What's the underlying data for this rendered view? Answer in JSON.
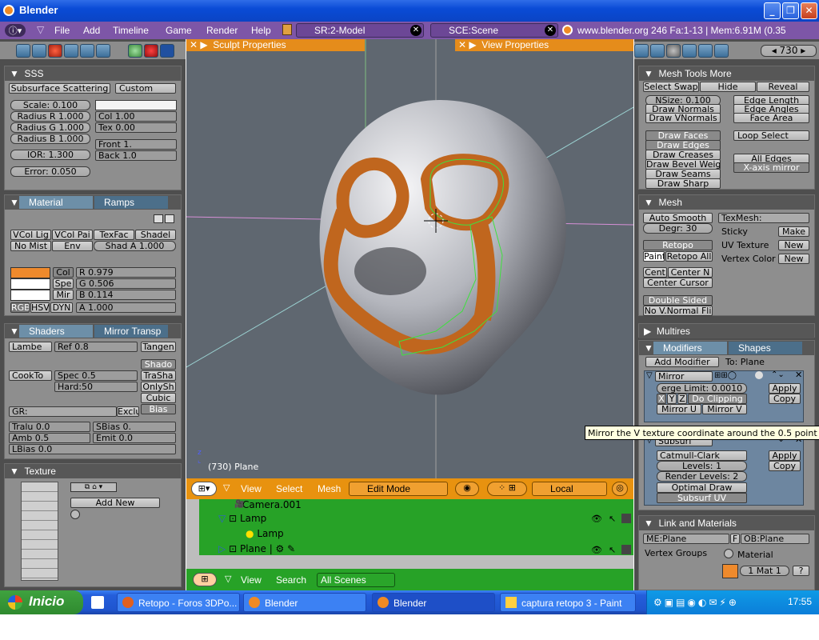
{
  "window": {
    "title": "Blender"
  },
  "info_header": {
    "menus": [
      "File",
      "Add",
      "Timeline",
      "Game",
      "Render",
      "Help"
    ],
    "screen": "SR:2-Model",
    "scene": "SCE:Scene",
    "stats": "www.blender.org 246  Fa:1-13 | Mem:6.91M (0.35"
  },
  "left_panels": {
    "sss": {
      "header": "SSS",
      "toggle": "Subsurface Scattering",
      "preset": "Custom",
      "scale": "Scale: 0.100",
      "radius_r": "Radius R 1.000",
      "radius_g": "Radius G 1.000",
      "radius_b": "Radius B 1.000",
      "ior": "IOR: 1.300",
      "error": "Error: 0.050",
      "col": "Col 1.00",
      "tex": "Tex 0.00",
      "front": "Front 1.",
      "back": "Back 1.0"
    },
    "material": {
      "tab1": "Material",
      "tab2": "Ramps",
      "row1": [
        "VCol Lig",
        "VCol Pai",
        "TexFac",
        "Shadel"
      ],
      "row2": [
        "No Mist",
        "Env",
        "Shad A 1.000"
      ],
      "col_tabs": [
        "Col",
        "Spe",
        "Mir"
      ],
      "r": "R 0.979",
      "g": "G 0.506",
      "b": "B 0.114",
      "a": "A 1.000",
      "modes": [
        "RGB",
        "HSV",
        "DYN"
      ],
      "color": "#ef8a2c"
    },
    "shaders": {
      "tab1": "Shaders",
      "tab2": "Mirror Transp",
      "diffuse": "Lambe",
      "ref": "Ref   0.8",
      "tangent": "Tangen",
      "spec_shader": "CookTo",
      "spec": "Spec 0.5",
      "hard": "Hard:50",
      "right_btns": [
        "Shado",
        "TraSha",
        "OnlySh",
        "Cubic",
        "Bias"
      ],
      "gr": "GR:",
      "exclusive": "Exclusive",
      "tralu": "Tralu 0.0",
      "sbias": "SBias 0.",
      "amb": "Amb 0.5",
      "emit": "Emit 0.0",
      "lbias": "LBias 0.0"
    },
    "texture": {
      "header": "Texture",
      "add_new": "Add New"
    }
  },
  "viewport": {
    "sculpt_props": "Sculpt Properties",
    "view_props": "View Properties",
    "object_label": "(730) Plane",
    "header_menus": [
      "View",
      "Select",
      "Mesh"
    ],
    "mode": "Edit Mode",
    "orientation": "Local"
  },
  "outliner": {
    "items": [
      "Camera.001",
      "Lamp",
      "Lamp",
      "Plane"
    ],
    "menus": [
      "View",
      "Search"
    ],
    "filter": "All Scenes"
  },
  "right_panels": {
    "frame": "730",
    "mesh_tools_more": {
      "header": "Mesh Tools More",
      "row1": [
        "Select Swap",
        "Hide",
        "Reveal"
      ],
      "nsize": "NSize: 0.100",
      "left": [
        "Draw Normals",
        "Draw VNormals"
      ],
      "right": [
        "Edge Length",
        "Edge Angles",
        "Face Area"
      ],
      "draw": [
        "Draw Faces",
        "Draw Edges",
        "Draw Creases",
        "Draw Bevel Weig",
        "Draw Seams",
        "Draw Sharp"
      ],
      "loop": "Loop Select",
      "all_edges": "All Edges",
      "xmirror": "X-axis mirror"
    },
    "mesh": {
      "header": "Mesh",
      "auto_smooth": "Auto Smooth",
      "degr": "Degr: 30",
      "texmesh": "TexMesh:",
      "sticky": "Sticky",
      "make": "Make",
      "uv_texture": "UV Texture",
      "vertex_color": "Vertex Color",
      "new": "New",
      "retopo": "Retopo",
      "paint": "Paint",
      "retopo_all": "Retopo All",
      "cent": "Cent",
      "center_n": "Center N",
      "center_cursor": "Center Cursor",
      "double_sided": "Double Sided",
      "no_vnormal": "No V.Normal Fli"
    },
    "multires": {
      "header": "Multires"
    },
    "modifiers": {
      "tab1": "Modifiers",
      "tab2": "Shapes",
      "add": "Add Modifier",
      "to": "To: Plane",
      "mirror": {
        "name": "Mirror",
        "merge": "erge Limit: 0.0010",
        "axes": [
          "X",
          "Y",
          "Z"
        ],
        "clip": "Do Clipping",
        "mirror_u": "Mirror U",
        "mirror_v": "Mirror V",
        "apply": "Apply",
        "copy": "Copy"
      },
      "subsurf": {
        "name": "Subsurf",
        "type": "Catmull-Clark",
        "levels": "Levels: 1",
        "render": "Render Levels: 2",
        "optimal": "Optimal Draw",
        "uv": "Subsurf UV",
        "apply": "Apply",
        "copy": "Copy"
      }
    },
    "link": {
      "header": "Link and Materials",
      "me": "ME:Plane",
      "f": "F",
      "ob": "OB:Plane",
      "vgroups": "Vertex Groups",
      "material": "Material",
      "mat": "1 Mat 1"
    }
  },
  "tooltip": "Mirror the V texture coordinate around the 0.5 point",
  "taskbar": {
    "start": "Inicio",
    "tasks": [
      "Retopo - Foros 3DPo...",
      "Blender",
      "Blender",
      "captura retopo 3 - Paint"
    ],
    "clock": "17:55"
  }
}
